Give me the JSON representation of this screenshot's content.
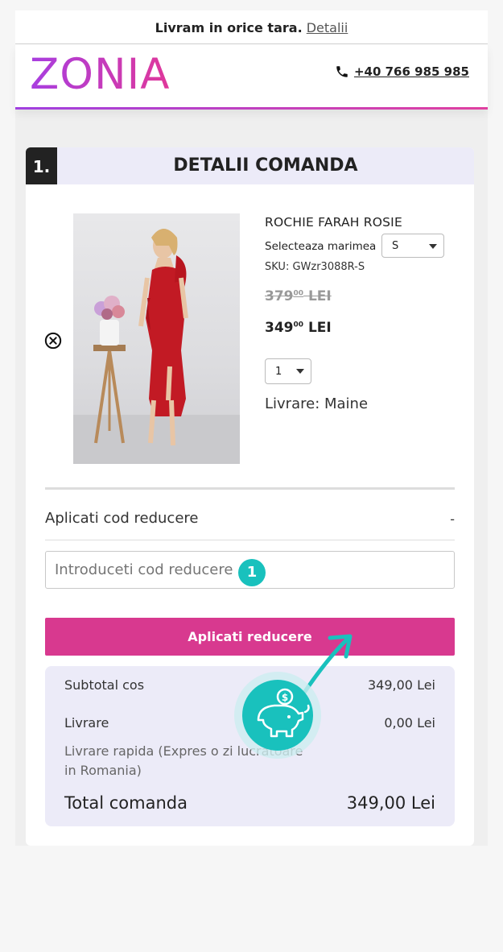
{
  "topbar": {
    "text": "Livram in orice tara.",
    "link": "Detalii"
  },
  "header": {
    "logo": "ZONIA",
    "phone": "+40 766 985 985"
  },
  "card": {
    "step": "1.",
    "title": "DETALII COMANDA"
  },
  "product": {
    "name": "ROCHIE FARAH ROSIE",
    "size_label": "Selecteaza marimea",
    "size_value": "S",
    "sku": "SKU: GWzr3088R-S",
    "old_price_int": "379",
    "old_price_dec": "00",
    "old_price_cur": "LEI",
    "new_price_int": "349",
    "new_price_dec": "00",
    "new_price_cur": "LEI",
    "quantity": "1",
    "delivery": "Livrare: Maine"
  },
  "discount": {
    "label": "Aplicati cod reducere",
    "toggle": "-",
    "placeholder": "Introduceti cod reducere",
    "badge": "1",
    "button": "Aplicati reducere"
  },
  "summary": {
    "subtotal_label": "Subtotal cos",
    "subtotal_value": "349,00 Lei",
    "shipping_label": "Livrare",
    "shipping_value": "0,00 Lei",
    "shipping_detail": "Livrare rapida (Expres o zi lucratoare in Romania)",
    "total_label": "Total comanda",
    "total_value": "349,00 Lei"
  },
  "colors": {
    "accent": "#d8398f",
    "teal": "#19c1bd",
    "summary_bg": "#ecebf8"
  },
  "icons": [
    "phone-icon",
    "remove-icon",
    "chevron-down-icon",
    "piggy-bank-icon",
    "arrow-icon"
  ]
}
